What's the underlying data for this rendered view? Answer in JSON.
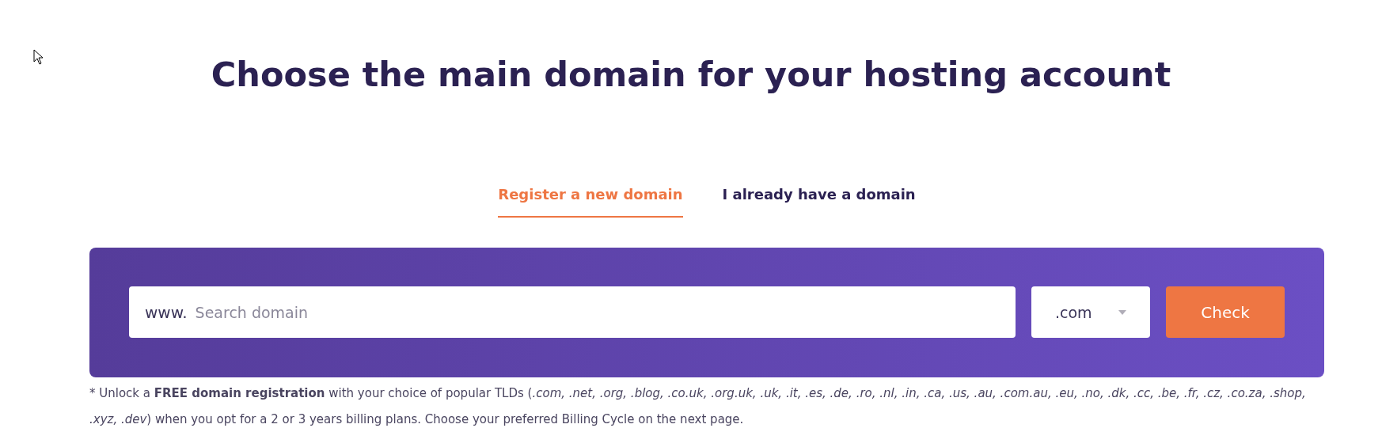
{
  "title": "Choose the main domain for your hosting account",
  "tabs": [
    {
      "label": "Register a new domain",
      "selected": true
    },
    {
      "label": "I already have a domain",
      "selected": false
    }
  ],
  "search": {
    "prefix": "www.",
    "placeholder": "Search domain"
  },
  "tld_select": {
    "value": ".com"
  },
  "check_button": "Check",
  "footnote": "* Unlock a **FREE domain registration** with your choice of popular TLDs (*.com, .net, .org, .blog, .co.uk, .org.uk, .uk, .it, .es, .de, .ro, .nl, .in, .ca, .us, .au, .com.au, .eu, .no, .dk, .cc, .be, .fr, .cz, .co.za, .shop, .xyz, .dev*) when you opt for a 2 or 3 years billing plans. Choose your preferred Billing Cycle on the next page."
}
